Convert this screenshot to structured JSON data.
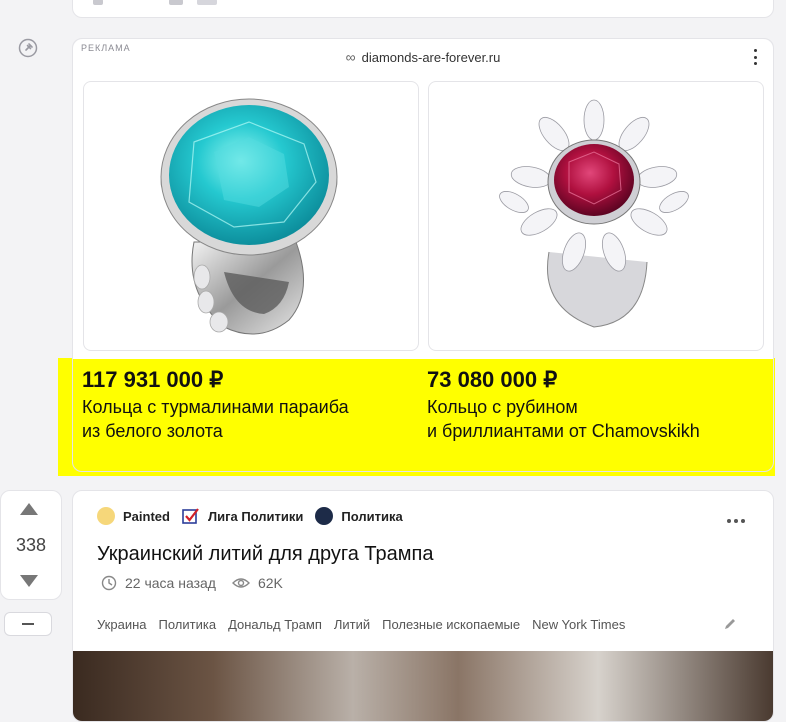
{
  "ad": {
    "label": "РЕКЛАМА",
    "domain": "diamonds-are-forever.ru",
    "products": [
      {
        "price": "117 931 000 ₽",
        "line1": "Кольца с турмалинами параиба",
        "line2": "из белого золота",
        "image": "paraiba-tourmaline-ring"
      },
      {
        "price": "73 080 000 ₽",
        "line1": "Кольцо с рубином",
        "line2": "и бриллиантами от Chamovskikh",
        "image": "ruby-diamond-ring"
      }
    ],
    "colors": {
      "highlight": "#ffff00"
    }
  },
  "post": {
    "votes": "338",
    "communities": [
      {
        "name": "Painted",
        "icon": "painted-avatar"
      },
      {
        "name": "Лига Политики",
        "icon": "checkbox-avatar"
      },
      {
        "name": "Политика",
        "icon": "globe-avatar"
      }
    ],
    "title": "Украинский литий для друга Трампа",
    "time": "22 часа назад",
    "views": "62K",
    "tags": [
      "Украина",
      "Политика",
      "Дональд Трамп",
      "Литий",
      "Полезные ископаемые",
      "New York Times"
    ]
  }
}
